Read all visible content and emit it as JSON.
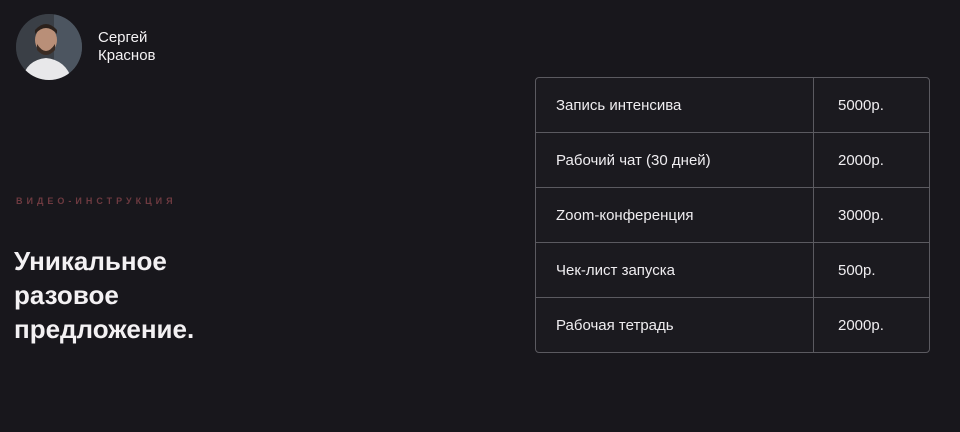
{
  "author": {
    "first_name": "Сергей",
    "last_name": "Краснов"
  },
  "eyebrow": "ВИДЕО-ИНСТРУКЦИЯ",
  "headline": {
    "line1": "Уникальное",
    "line2": "разовое",
    "line3": "предложение."
  },
  "price_table": {
    "rows": [
      {
        "item": "Запись интенсива",
        "price": "5000р."
      },
      {
        "item": "Рабочий чат (30 дней)",
        "price": "2000р."
      },
      {
        "item": "Zoom-конференция",
        "price": "3000р."
      },
      {
        "item": "Чек-лист запуска",
        "price": "500р."
      },
      {
        "item": "Рабочая тетрадь",
        "price": "2000р."
      }
    ]
  },
  "colors": {
    "background": "#18171c",
    "eyebrow": "#6e3a40",
    "table_border": "#5b5a60"
  }
}
